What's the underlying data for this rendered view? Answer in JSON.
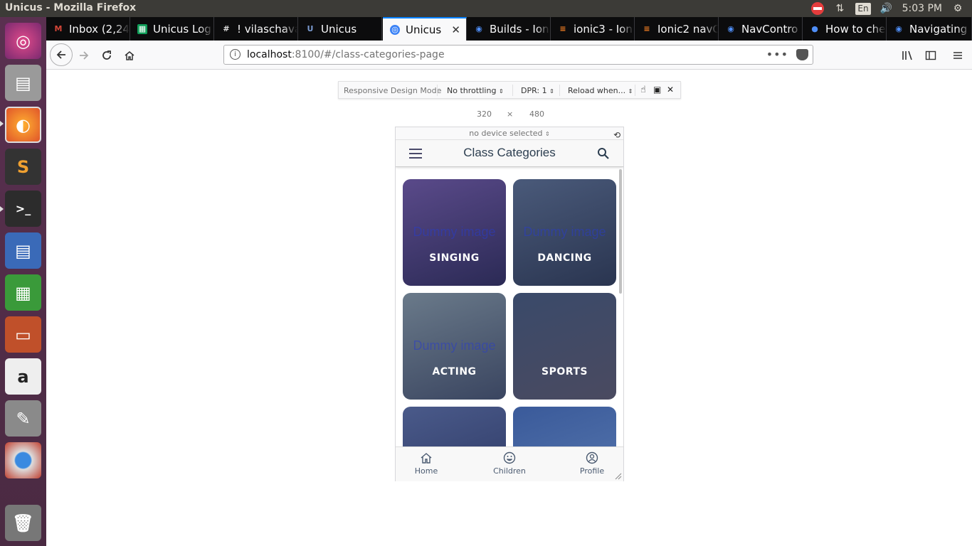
{
  "window": {
    "title": "Unicus - Mozilla Firefox"
  },
  "tray": {
    "lang": "En",
    "time": "5:03 PM"
  },
  "tabs": [
    {
      "label": "Inbox (2,24",
      "color": "#d44638",
      "glyph": "M"
    },
    {
      "label": "Unicus Log",
      "color": "#0f9d58",
      "glyph": "▦"
    },
    {
      "label": "! vilaschava",
      "color": "#888888",
      "glyph": "#"
    },
    {
      "label": "Unicus",
      "color": "#5b7fc7",
      "glyph": "U"
    },
    {
      "label": "Unicus",
      "color": "#3b82f6",
      "glyph": "◎"
    },
    {
      "label": "Builds - Ion",
      "color": "#4f8ef7",
      "glyph": "◉"
    },
    {
      "label": "ionic3 - Ion",
      "color": "#f48024",
      "glyph": "≡"
    },
    {
      "label": "Ionic2 navC",
      "color": "#f48024",
      "glyph": "≡"
    },
    {
      "label": "NavContro",
      "color": "#4f8ef7",
      "glyph": "◉"
    },
    {
      "label": "How to che",
      "color": "#4f8ef7",
      "glyph": "●"
    },
    {
      "label": "Navigating",
      "color": "#4f8ef7",
      "glyph": "◉"
    }
  ],
  "urlbar": {
    "host": "localhost",
    "path": ":8100/#/class-categories-page"
  },
  "rdm": {
    "mode": "Responsive Design Mode",
    "throttling": "No throttling",
    "dpr": "DPR: 1",
    "reload": "Reload when...",
    "width": "320",
    "times": "×",
    "height": "480",
    "device": "no device selected"
  },
  "app": {
    "title": "Class Categories",
    "placeholder": "Dummy image",
    "categories": [
      {
        "label": "SINGING",
        "bg1": "#5a4a8a",
        "bg2": "#2b2a55"
      },
      {
        "label": "DANCING",
        "bg1": "#4a5a7a",
        "bg2": "#2a3550"
      },
      {
        "label": "ACTING",
        "bg1": "#6a7a8a",
        "bg2": "#3a4560"
      },
      {
        "label": "SPORTS",
        "bg1": "#3a4a6a",
        "bg2": "#4a4a60"
      },
      {
        "label": "",
        "bg1": "#4a5a8a",
        "bg2": "#2a3560"
      },
      {
        "label": "",
        "bg1": "#3a5a9a",
        "bg2": "#5a7ab0"
      }
    ],
    "bottom_tabs": [
      {
        "label": "Home"
      },
      {
        "label": "Children"
      },
      {
        "label": "Profile"
      }
    ]
  }
}
